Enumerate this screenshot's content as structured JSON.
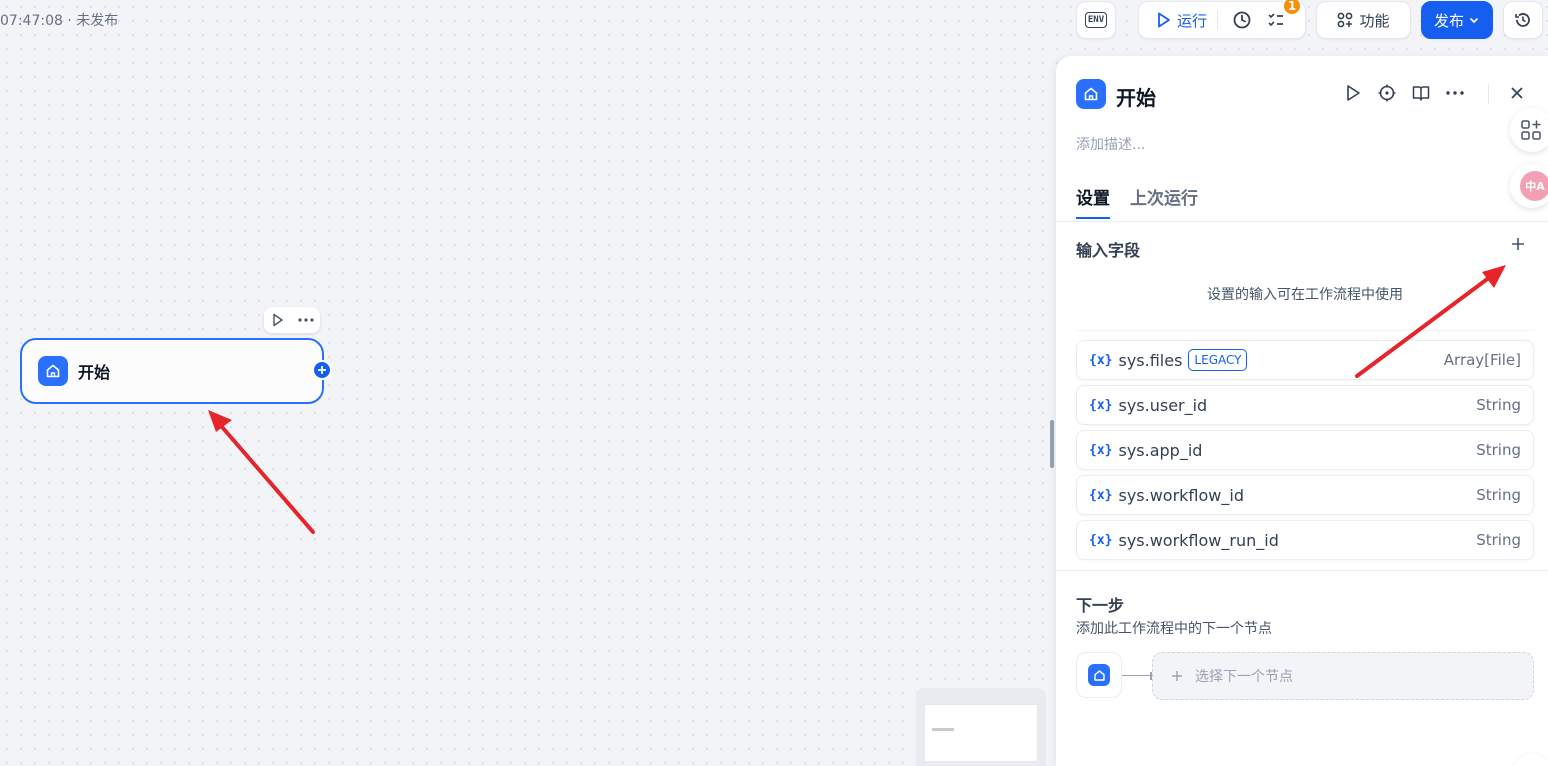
{
  "status": {
    "text": "07:47:08 · 未发布"
  },
  "toolbar": {
    "env_label": "ENV",
    "run_label": "运行",
    "checklist_badge": "1",
    "features_label": "功能",
    "publish_label": "发布"
  },
  "canvas": {
    "start_node": {
      "title": "开始"
    }
  },
  "panel": {
    "title": "开始",
    "description_placeholder": "添加描述...",
    "tabs": [
      {
        "label": "设置",
        "active": true
      },
      {
        "label": "上次运行",
        "active": false
      }
    ],
    "input_fields": {
      "title": "输入字段",
      "hint": "设置的输入可在工作流程中使用",
      "variables": [
        {
          "icon": "{x}",
          "name": "sys.files",
          "tag": "LEGACY",
          "type": "Array[File]"
        },
        {
          "icon": "{x}",
          "name": "sys.user_id",
          "type": "String"
        },
        {
          "icon": "{x}",
          "name": "sys.app_id",
          "type": "String"
        },
        {
          "icon": "{x}",
          "name": "sys.workflow_id",
          "type": "String"
        },
        {
          "icon": "{x}",
          "name": "sys.workflow_run_id",
          "type": "String"
        }
      ]
    },
    "next_step": {
      "title": "下一步",
      "description": "添加此工作流程中的下一个节点",
      "select_label": "选择下一个节点"
    }
  },
  "side": {
    "translate_label": "中A"
  },
  "colors": {
    "accent": "#155eef",
    "node_blue": "#2970ff",
    "arrow": "#e5252a",
    "badge": "#f79009"
  }
}
